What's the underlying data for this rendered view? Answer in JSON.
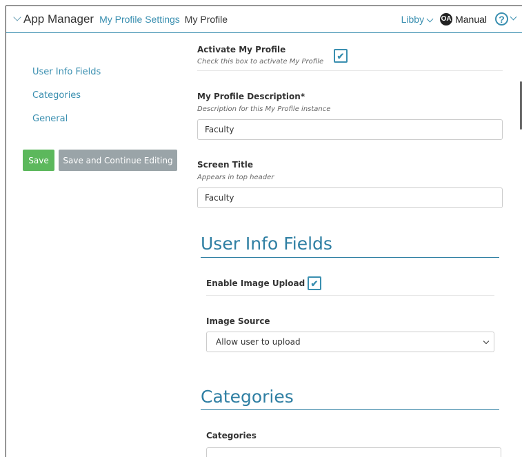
{
  "header": {
    "app_name": "App Manager",
    "breadcrumb_1": "My Profile Settings",
    "breadcrumb_2": "My Profile",
    "user": "Libby",
    "oa_logo": "OA",
    "manual": "Manual",
    "help_icon": "?"
  },
  "sidebar": {
    "items": [
      {
        "label": "User Info Fields"
      },
      {
        "label": "Categories"
      },
      {
        "label": "General"
      }
    ],
    "save_label": "Save",
    "save_continue_label": "Save and Continue Editing"
  },
  "form": {
    "activate": {
      "label": "Activate My Profile",
      "help": "Check this box to activate My Profile",
      "checked": true
    },
    "description": {
      "label": "My Profile Description*",
      "help": "Description for this My Profile instance",
      "value": "Faculty"
    },
    "screen_title": {
      "label": "Screen Title",
      "help": "Appears in top header",
      "value": "Faculty"
    },
    "user_info_fields": {
      "title": "User Info Fields",
      "enable_image_upload": {
        "label": "Enable Image Upload",
        "checked": true
      },
      "image_source": {
        "label": "Image Source",
        "selected": "Allow user to upload"
      }
    },
    "categories": {
      "title": "Categories",
      "label": "Categories"
    }
  },
  "colors": {
    "accent": "#3a8fb0",
    "save": "#5cb85c",
    "save_continue": "#9aa4a8"
  }
}
